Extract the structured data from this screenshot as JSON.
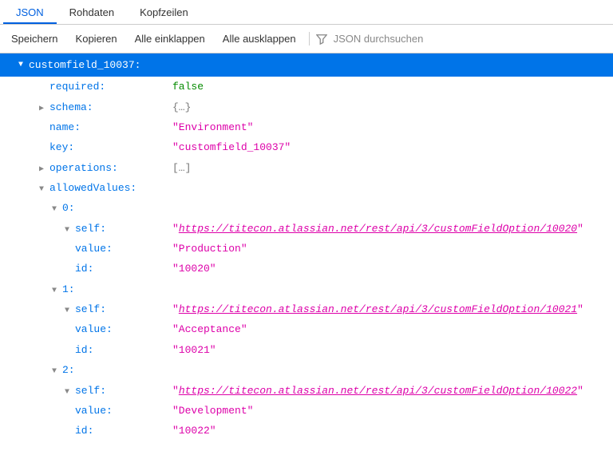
{
  "tabs": {
    "json": "JSON",
    "raw": "Rohdaten",
    "headers": "Kopfzeilen"
  },
  "toolbar": {
    "save": "Speichern",
    "copy": "Kopieren",
    "collapse_all": "Alle einklappen",
    "expand_all": "Alle ausklappen",
    "search_placeholder": "JSON durchsuchen"
  },
  "glyph": {
    "down": "▼",
    "right": "▶",
    "obj_collapsed": "{…}",
    "arr_collapsed": "[…]"
  },
  "root": {
    "key": "customfield_10037:"
  },
  "fields": {
    "required": {
      "k": "required:",
      "v": "false"
    },
    "schema": {
      "k": "schema:"
    },
    "name": {
      "k": "name:",
      "v": "\"Environment\""
    },
    "keyf": {
      "k": "key:",
      "v": "\"customfield_10037\""
    },
    "operations": {
      "k": "operations:"
    },
    "allowed": {
      "k": "allowedValues:"
    }
  },
  "items": [
    {
      "idx": "0:",
      "self_k": "self:",
      "self_v": "https://titecon.atlassian.net/rest/api/3/customFieldOption/10020",
      "value_k": "value:",
      "value_v": "\"Production\"",
      "id_k": "id:",
      "id_v": "\"10020\""
    },
    {
      "idx": "1:",
      "self_k": "self:",
      "self_v": "https://titecon.atlassian.net/rest/api/3/customFieldOption/10021",
      "value_k": "value:",
      "value_v": "\"Acceptance\"",
      "id_k": "id:",
      "id_v": "\"10021\""
    },
    {
      "idx": "2:",
      "self_k": "self:",
      "self_v": "https://titecon.atlassian.net/rest/api/3/customFieldOption/10022",
      "value_k": "value:",
      "value_v": "\"Development\"",
      "id_k": "id:",
      "id_v": "\"10022\""
    }
  ]
}
